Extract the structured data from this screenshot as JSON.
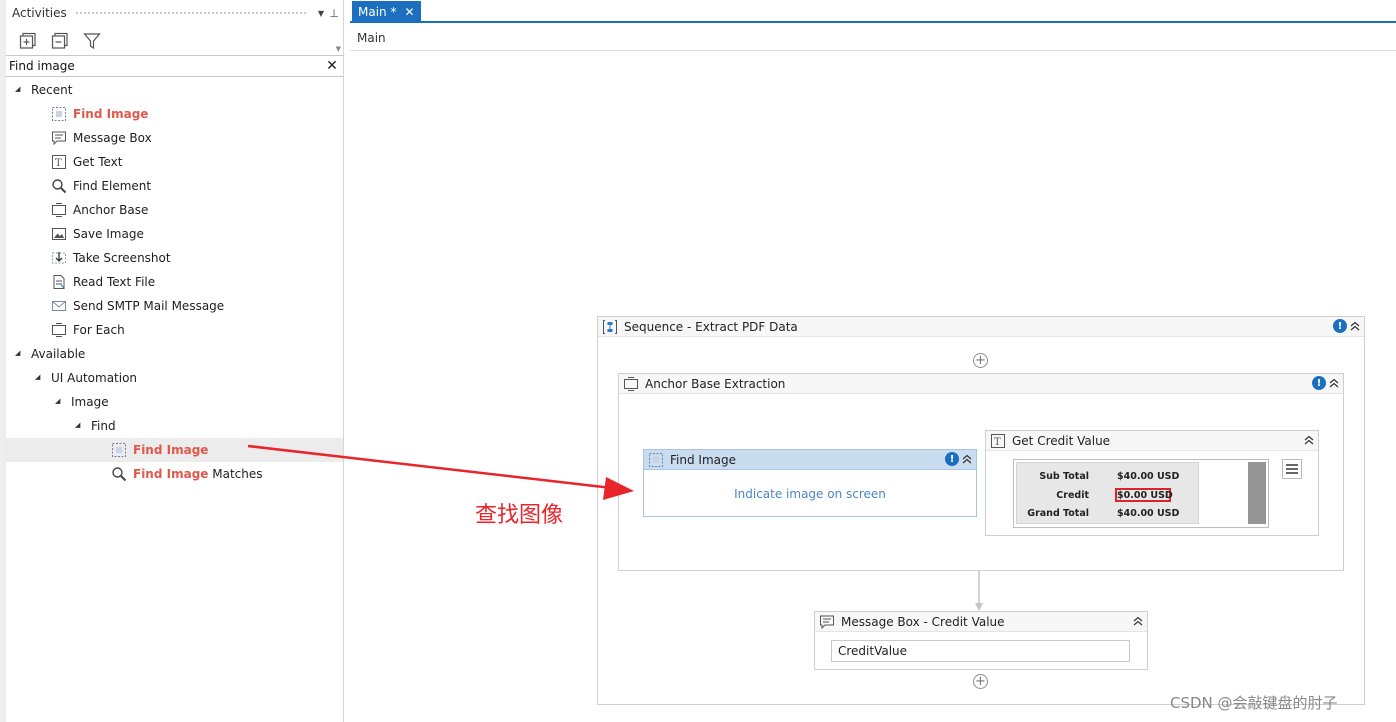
{
  "panel": {
    "title": "Activities",
    "search_value": "Find image"
  },
  "tree": {
    "recent_label": "Recent",
    "recent_items": [
      "Find Image",
      "Message Box",
      "Get Text",
      "Find Element",
      "Anchor Base",
      "Save Image",
      "Take Screenshot",
      "Read Text File",
      "Send SMTP Mail Message",
      "For Each"
    ],
    "available_label": "Available",
    "ui_automation_label": "UI Automation",
    "image_label": "Image",
    "find_label": "Find",
    "find_image_label": "Find Image",
    "find_image_matches_hl": "Find Image",
    "find_image_matches_rest": " Matches"
  },
  "designer": {
    "tab_label": "Main *",
    "breadcrumb": "Main"
  },
  "workflow": {
    "sequence_title": "Sequence - Extract PDF Data",
    "anchor_title": "Anchor Base Extraction",
    "find_image_title": "Find Image",
    "indicate_link": "Indicate image on screen",
    "get_credit_title": "Get Credit Value",
    "preview_rows": [
      {
        "label": "Sub Total",
        "value": "$40.00 USD"
      },
      {
        "label": "Credit",
        "value": "$0.00 USD"
      },
      {
        "label": "Grand Total",
        "value": "$40.00 USD"
      }
    ],
    "message_box_title": "Message Box - Credit Value",
    "message_box_value": "CreditValue"
  },
  "annotation_text": "查找图像",
  "watermark": "CSDN @会敲键盘的肘子",
  "colors": {
    "accent": "#1c6fbf",
    "highlight_text": "#e0584b",
    "annotation": "#e8252a"
  }
}
